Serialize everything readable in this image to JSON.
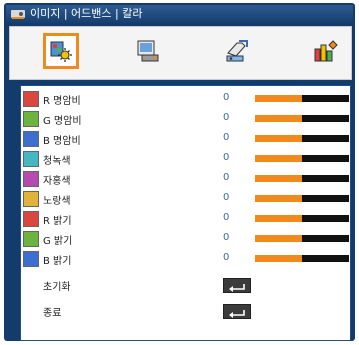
{
  "title": "이미지 | 어드밴스 | 칼라",
  "toolbar": {
    "items": [
      {
        "name": "image-settings-icon",
        "selected": true
      },
      {
        "name": "display-icon",
        "selected": false
      },
      {
        "name": "setup-icon",
        "selected": false
      },
      {
        "name": "options-icon",
        "selected": false
      }
    ]
  },
  "colors": {
    "accent": "#f08a1c",
    "frame": "#133b6b",
    "value_text": "#3a6bb0"
  },
  "rows": [
    {
      "label": "R 명암비",
      "value": "0",
      "level": 0.5,
      "icon_color": "#d9473f"
    },
    {
      "label": "G 명암비",
      "value": "0",
      "level": 0.5,
      "icon_color": "#6cb33f"
    },
    {
      "label": "B 명암비",
      "value": "0",
      "level": 0.5,
      "icon_color": "#3b6fd0"
    },
    {
      "label": "청녹색",
      "value": "0",
      "level": 0.5,
      "icon_color": "#45b6c2"
    },
    {
      "label": "자홍색",
      "value": "0",
      "level": 0.5,
      "icon_color": "#b54bb0"
    },
    {
      "label": "노랑색",
      "value": "0",
      "level": 0.5,
      "icon_color": "#e0b43a"
    },
    {
      "label": "R 밝기",
      "value": "0",
      "level": 0.5,
      "icon_color": "#d9473f"
    },
    {
      "label": "G 밝기",
      "value": "0",
      "level": 0.5,
      "icon_color": "#6cb33f"
    },
    {
      "label": "B 밝기",
      "value": "0",
      "level": 0.5,
      "icon_color": "#3b6fd0"
    }
  ],
  "actions": [
    {
      "label": "초기화",
      "icon": "enter-icon"
    },
    {
      "label": "종료",
      "icon": "enter-icon"
    }
  ]
}
